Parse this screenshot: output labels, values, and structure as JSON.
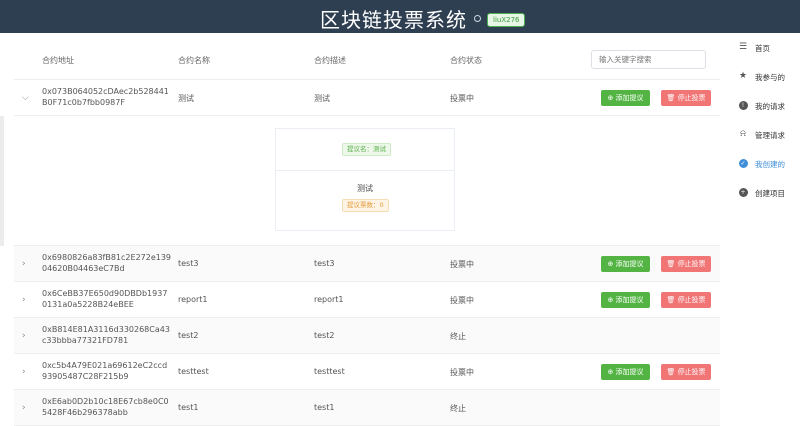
{
  "header": {
    "title": "区块链投票系统",
    "user": "liuX276"
  },
  "search": {
    "placeholder": "输入关键字搜索"
  },
  "columns": {
    "address": "合约地址",
    "name": "合约名称",
    "desc": "合约描述",
    "status": "合约状态"
  },
  "buttons": {
    "add": "添加提议",
    "stop": "停止投票"
  },
  "rows": [
    {
      "address": "0x073B064052cDAec2b528441B0F71c0b7fbb0987F",
      "name": "测试",
      "desc": "测试",
      "status": "投票中",
      "expanded": true
    },
    {
      "address": "0x6980826a83fB81c2E272e13904620B04463eC7Bd",
      "name": "test3",
      "desc": "test3",
      "status": "投票中"
    },
    {
      "address": "0x6CeBB37E650d90DBDb19370131a0a5228B24eBEE",
      "name": "report1",
      "desc": "report1",
      "status": "投票中"
    },
    {
      "address": "0xB814E81A3116d330268Ca43c33bbba77321FD781",
      "name": "test2",
      "desc": "test2",
      "status": "终止"
    },
    {
      "address": "0xc5b4A79E021a69612eC2ccd93905487C28F215b9",
      "name": "testtest",
      "desc": "testtest",
      "status": "投票中"
    },
    {
      "address": "0xE6ab0D2b10c18E67cb8e0C05428F46b296378abb",
      "name": "test1",
      "desc": "test1",
      "status": "终止"
    }
  ],
  "proposal": {
    "name_tag": "提议名：测试",
    "title": "测试",
    "votes_tag": "提议票数：0"
  },
  "sidebar": {
    "items": [
      {
        "label": "首页",
        "icon": "document-icon"
      },
      {
        "label": "我参与的",
        "icon": "star-icon"
      },
      {
        "label": "我的请求",
        "icon": "info-icon"
      },
      {
        "label": "管理请求",
        "icon": "bell-icon"
      },
      {
        "label": "我创建的",
        "icon": "check-circle-icon"
      },
      {
        "label": "创建项目",
        "icon": "plus-circle-icon"
      }
    ],
    "active_index": 4
  },
  "colors": {
    "header_bg": "#2f3f52",
    "add_button": "#53b443",
    "stop_button": "#f27575",
    "active": "#3e8ed8"
  }
}
